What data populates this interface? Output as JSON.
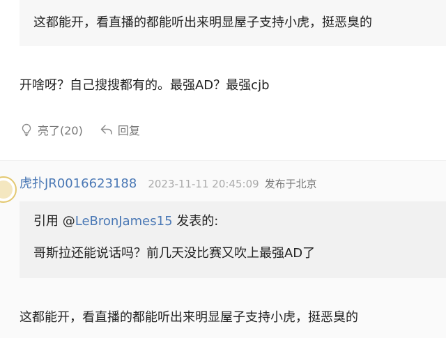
{
  "previous_post": {
    "quote_text": "这都能开，看直播的都能听出来明显屋子支持小虎，挺恶臭的",
    "reply_text": "开啥呀？自己搜搜都有的。最强AD？最强cjb",
    "actions": {
      "like_label": "亮了(20)",
      "reply_label": "回复"
    }
  },
  "post": {
    "username": "虎扑JR0016623188",
    "timestamp": "2023-11-11 20:45:09",
    "location": "发布于北京",
    "quote": {
      "prefix": "引用 @",
      "mention": "LeBronJames15",
      "suffix": " 发表的:",
      "text": "哥斯拉还能说话吗？前几天没比赛又吹上最强AD了"
    },
    "reply_text": "这都能开，看直播的都能听出来明显屋子支持小虎，挺恶臭的"
  },
  "colors": {
    "link": "#4a78b5",
    "text": "#222222",
    "muted": "#777777",
    "quote_bg": "#f1f1f1"
  }
}
